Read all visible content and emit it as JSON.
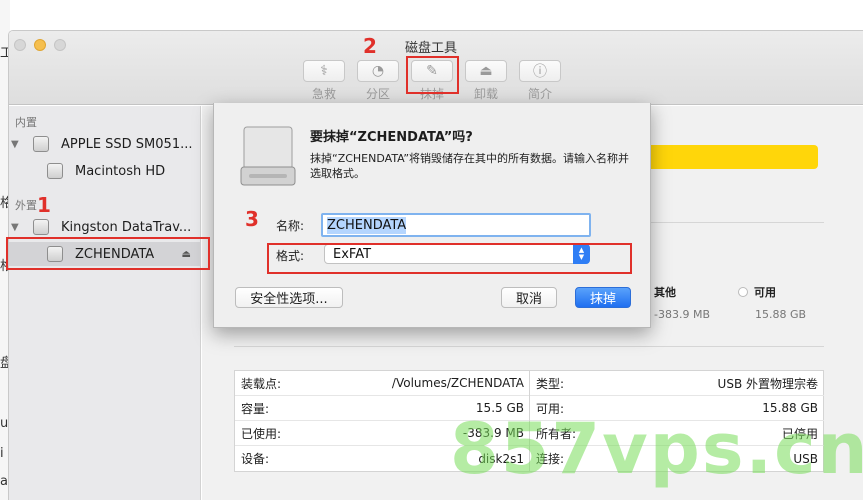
{
  "window": {
    "title": "磁盘工具"
  },
  "toolbar": [
    {
      "label": "急救",
      "icon": "first-aid-icon",
      "glyph": "⚕"
    },
    {
      "label": "分区",
      "icon": "partition-icon",
      "glyph": "◔"
    },
    {
      "label": "抹掉",
      "icon": "erase-icon",
      "glyph": "✎"
    },
    {
      "label": "卸载",
      "icon": "unmount-icon",
      "glyph": "⏏"
    },
    {
      "label": "简介",
      "icon": "info-icon",
      "glyph": "ⓘ"
    }
  ],
  "sidebar": {
    "internal_header": "内置",
    "external_header": "外置",
    "items": [
      {
        "label": "APPLE SSD SM051..."
      },
      {
        "label": "Macintosh HD"
      },
      {
        "label": "Kingston DataTrav..."
      },
      {
        "label": "ZCHENDATA",
        "eject": "⏏"
      }
    ]
  },
  "dialog": {
    "title": "要抹掉“ZCHENDATA”吗?",
    "message": "抹掉“ZCHENDATA”将销毁储存在其中的所有数据。请输入名称并选取格式。",
    "name_label": "名称:",
    "name_value": "ZCHENDATA",
    "format_label": "格式:",
    "format_value": "ExFAT",
    "security_button": "安全性选项...",
    "cancel_button": "取消",
    "erase_button": "抹掉"
  },
  "usage": {
    "bar_color": "#ffd60a",
    "other": {
      "title": "其他",
      "value": "-383.9 MB"
    },
    "available": {
      "title": "可用",
      "value": "15.88 GB"
    }
  },
  "info": {
    "left": [
      {
        "key": "装载点:",
        "value": "/Volumes/ZCHENDATA"
      },
      {
        "key": "容量:",
        "value": "15.5 GB"
      },
      {
        "key": "已使用:",
        "value": "-383.9 MB"
      },
      {
        "key": "设备:",
        "value": "disk2s1"
      }
    ],
    "right": [
      {
        "key": "类型:",
        "value": "USB 外置物理宗卷"
      },
      {
        "key": "可用:",
        "value": "15.88 GB"
      },
      {
        "key": "所有者:",
        "value": "已停用"
      },
      {
        "key": "连接:",
        "value": "USB"
      }
    ]
  },
  "annotations": {
    "step1": "1",
    "step2": "2",
    "step3": "3",
    "color": "#e0302a"
  },
  "watermark": "857vps.cn",
  "background_edge": {
    "chars": [
      "工",
      "格",
      "格",
      "盘",
      "u",
      "i",
      "a"
    ]
  }
}
